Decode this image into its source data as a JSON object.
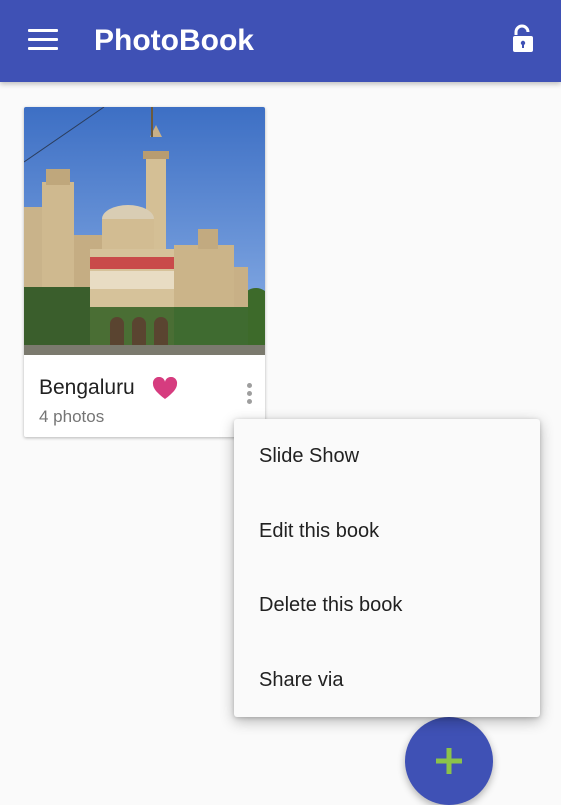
{
  "app": {
    "title": "PhotoBook",
    "colors": {
      "primary": "#3f51b5",
      "fab_icon": "#8bc34a",
      "heart": "#d63c7f"
    },
    "icons": {
      "menu": "menu-icon",
      "lock": "lock-open-icon",
      "add": "plus-icon"
    }
  },
  "book": {
    "title": "Bengaluru",
    "count": "4 photos",
    "favorite": true
  },
  "popup_menu": {
    "items": [
      "Slide Show",
      "Edit this book",
      "Delete this book",
      "Share via"
    ]
  }
}
